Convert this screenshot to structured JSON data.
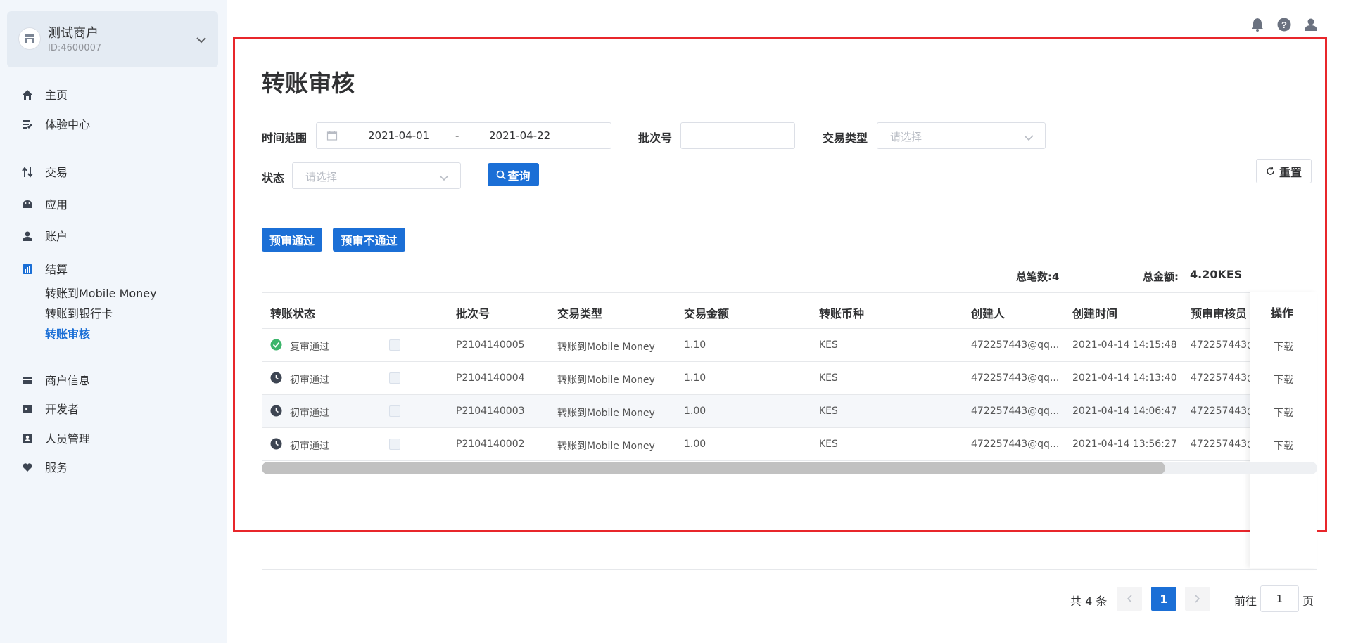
{
  "sidebar": {
    "merchant_name": "测试商户",
    "merchant_id": "ID:4600007",
    "nav": [
      {
        "label": "主页",
        "icon": "home-icon"
      },
      {
        "label": "体验中心",
        "icon": "experience-icon"
      },
      {
        "label": "交易",
        "icon": "transfer-arrows-icon"
      },
      {
        "label": "应用",
        "icon": "android-icon"
      },
      {
        "label": "账户",
        "icon": "user-icon"
      },
      {
        "label": "结算",
        "icon": "bar-chart-icon"
      },
      {
        "label": "商户信息",
        "icon": "card-icon"
      },
      {
        "label": "开发者",
        "icon": "terminal-icon"
      },
      {
        "label": "人员管理",
        "icon": "contact-icon"
      },
      {
        "label": "服务",
        "icon": "heart-icon"
      }
    ],
    "sub": [
      "转账到Mobile Money",
      "转账到银行卡",
      "转账审核"
    ]
  },
  "page": {
    "title": "转账审核"
  },
  "filters": {
    "time_label": "时间范围",
    "date_start": "2021-04-01",
    "date_sep": "-",
    "date_end": "2021-04-22",
    "batch_label": "批次号",
    "batch_value": "",
    "type_label": "交易类型",
    "type_placeholder": "请选择",
    "status_label": "状态",
    "status_placeholder": "请选择",
    "query_label": "查询",
    "reset_label": "重置"
  },
  "actions": {
    "approve": "预审通过",
    "reject": "预审不通过"
  },
  "summary": {
    "count_label": "总笔数:4",
    "amount_label": "总金额:",
    "amount_value": "4.20KES"
  },
  "table": {
    "columns": [
      "转账状态",
      "批次号",
      "交易类型",
      "交易金额",
      "转账币种",
      "创建人",
      "创建时间",
      "预审审核员",
      "操作"
    ],
    "rows": [
      {
        "status": "复审通过",
        "status_icon": "check-circle-icon",
        "batch": "P2104140005",
        "type": "转账到Mobile Money",
        "amount": "1.10",
        "currency": "KES",
        "creator": "472257443@qq...",
        "time": "2021-04-14 14:15:48",
        "reviewer": "472257443@",
        "op": "下载"
      },
      {
        "status": "初审通过",
        "status_icon": "clock-icon",
        "batch": "P2104140004",
        "type": "转账到Mobile Money",
        "amount": "1.10",
        "currency": "KES",
        "creator": "472257443@qq...",
        "time": "2021-04-14 14:13:40",
        "reviewer": "472257443@",
        "op": "下载"
      },
      {
        "status": "初审通过",
        "status_icon": "clock-icon",
        "batch": "P2104140003",
        "type": "转账到Mobile Money",
        "amount": "1.00",
        "currency": "KES",
        "creator": "472257443@qq...",
        "time": "2021-04-14 14:06:47",
        "reviewer": "472257443@",
        "op": "下载"
      },
      {
        "status": "初审通过",
        "status_icon": "clock-icon",
        "batch": "P2104140002",
        "type": "转账到Mobile Money",
        "amount": "1.00",
        "currency": "KES",
        "creator": "472257443@qq...",
        "time": "2021-04-14 13:56:27",
        "reviewer": "472257443@",
        "op": "下载"
      }
    ]
  },
  "pagination": {
    "total": "共 4 条",
    "current": "1",
    "goto_prefix": "前往",
    "goto_value": "1",
    "goto_suffix": "页"
  },
  "colors": {
    "primary": "#1b6fd6",
    "highlight_border": "#e8262b",
    "success": "#3bb56a"
  }
}
